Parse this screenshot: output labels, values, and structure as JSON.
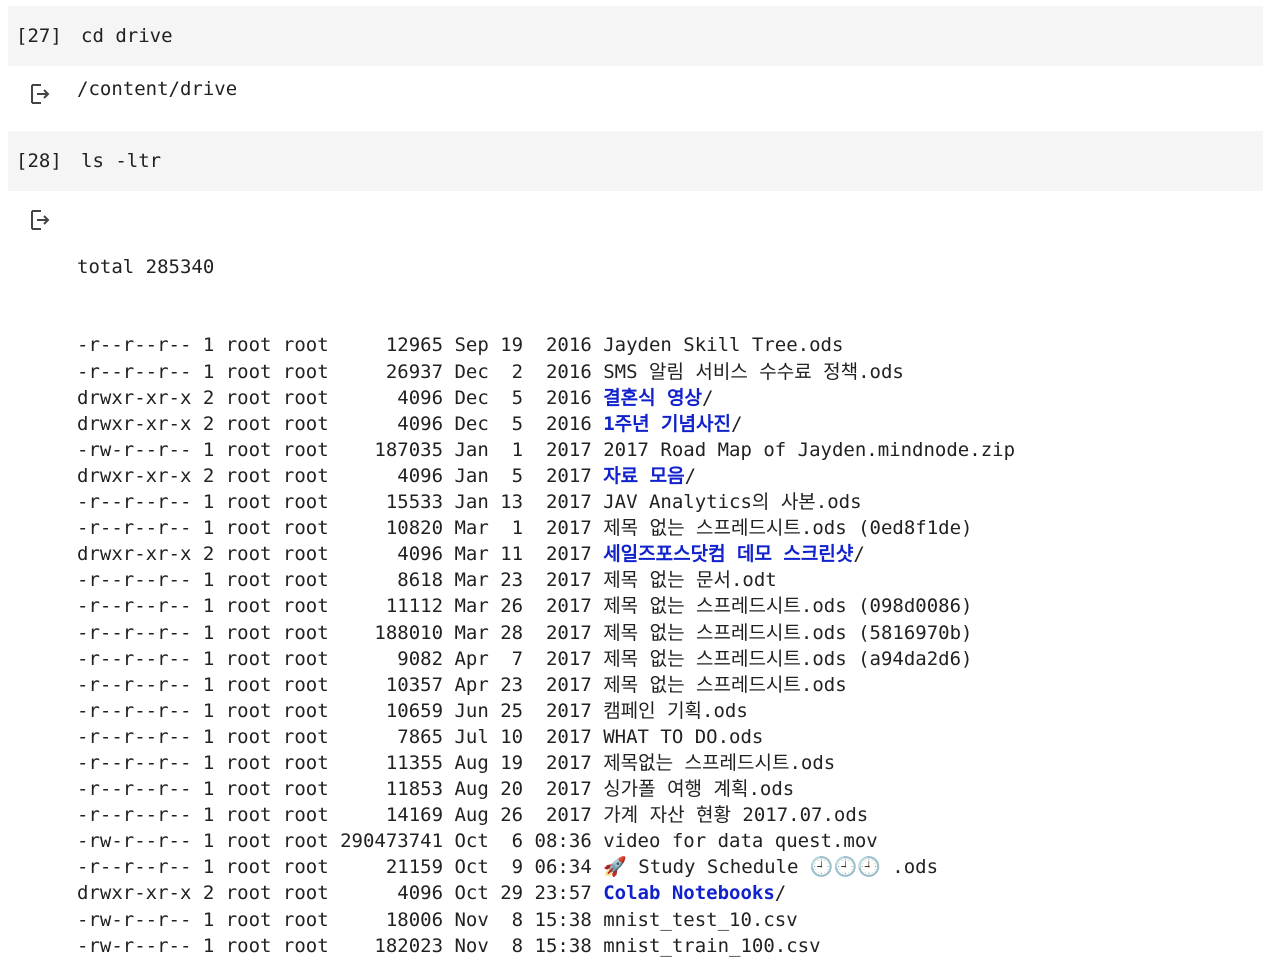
{
  "cells": [
    {
      "exec_count": "[27]",
      "code": "cd drive",
      "output": "/content/drive"
    },
    {
      "exec_count": "[28]",
      "code": "ls -ltr",
      "total": "total 285340",
      "rows": [
        {
          "prefix": "-r--r--r-- 1 root root     12965 Sep 19  2016 ",
          "name": "Jayden Skill Tree.ods",
          "suffix": ""
        },
        {
          "prefix": "-r--r--r-- 1 root root     26937 Dec  2  2016 ",
          "name": "SMS 알림 서비스 수수료 정책.ods",
          "suffix": ""
        },
        {
          "prefix": "drwxr-xr-x 2 root root      4096 Dec  5  2016 ",
          "dir": "결혼식 영상",
          "suffix": "/"
        },
        {
          "prefix": "drwxr-xr-x 2 root root      4096 Dec  5  2016 ",
          "dir": "1주년 기념사진",
          "suffix": "/"
        },
        {
          "prefix": "-rw-r--r-- 1 root root    187035 Jan  1  2017 ",
          "name": "2017 Road Map of Jayden.mindnode.zip",
          "suffix": ""
        },
        {
          "prefix": "drwxr-xr-x 2 root root      4096 Jan  5  2017 ",
          "dir": "자료 모음",
          "suffix": "/"
        },
        {
          "prefix": "-r--r--r-- 1 root root     15533 Jan 13  2017 ",
          "name": "JAV Analytics의 사본.ods",
          "suffix": ""
        },
        {
          "prefix": "-r--r--r-- 1 root root     10820 Mar  1  2017 ",
          "name": "제목 없는 스프레드시트.ods (0ed8f1de)",
          "suffix": ""
        },
        {
          "prefix": "drwxr-xr-x 2 root root      4096 Mar 11  2017 ",
          "dir": "세일즈포스닷컴 데모 스크린샷",
          "suffix": "/"
        },
        {
          "prefix": "-r--r--r-- 1 root root      8618 Mar 23  2017 ",
          "name": "제목 없는 문서.odt",
          "suffix": ""
        },
        {
          "prefix": "-r--r--r-- 1 root root     11112 Mar 26  2017 ",
          "name": "제목 없는 스프레드시트.ods (098d0086)",
          "suffix": ""
        },
        {
          "prefix": "-r--r--r-- 1 root root    188010 Mar 28  2017 ",
          "name": "제목 없는 스프레드시트.ods (5816970b)",
          "suffix": ""
        },
        {
          "prefix": "-r--r--r-- 1 root root      9082 Apr  7  2017 ",
          "name": "제목 없는 스프레드시트.ods (a94da2d6)",
          "suffix": ""
        },
        {
          "prefix": "-r--r--r-- 1 root root     10357 Apr 23  2017 ",
          "name": "제목 없는 스프레드시트.ods",
          "suffix": ""
        },
        {
          "prefix": "-r--r--r-- 1 root root     10659 Jun 25  2017 ",
          "name": "캠페인 기획.ods",
          "suffix": ""
        },
        {
          "prefix": "-r--r--r-- 1 root root      7865 Jul 10  2017 ",
          "name": "WHAT TO DO.ods",
          "suffix": ""
        },
        {
          "prefix": "-r--r--r-- 1 root root     11355 Aug 19  2017 ",
          "name": "제목없는 스프레드시트.ods",
          "suffix": ""
        },
        {
          "prefix": "-r--r--r-- 1 root root     11853 Aug 20  2017 ",
          "name": "싱가폴 여행 계획.ods",
          "suffix": ""
        },
        {
          "prefix": "-r--r--r-- 1 root root     14169 Aug 26  2017 ",
          "name": "가계 자산 현황 2017.07.ods",
          "suffix": ""
        },
        {
          "prefix": "-rw-r--r-- 1 root root 290473741 Oct  6 08:36 ",
          "name": "video for data quest.mov",
          "suffix": ""
        },
        {
          "prefix": "-r--r--r-- 1 root root     21159 Oct  9 06:34 ",
          "name": "🚀 Study Schedule 🕘🕘🕘 .ods",
          "suffix": ""
        },
        {
          "prefix": "drwxr-xr-x 2 root root      4096 Oct 29 23:57 ",
          "dir": "Colab Notebooks",
          "suffix": "/"
        },
        {
          "prefix": "-rw-r--r-- 1 root root     18006 Nov  8 15:38 ",
          "name": "mnist_test_10.csv",
          "suffix": ""
        },
        {
          "prefix": "-rw-r--r-- 1 root root    182023 Nov  8 15:38 ",
          "name": "mnist_train_100.csv",
          "suffix": ""
        }
      ]
    }
  ],
  "icons": {
    "output": "output-arrow-icon"
  },
  "colors": {
    "cell_bg": "#f5f5f5",
    "text": "#212121",
    "directory": "#1122cc"
  }
}
